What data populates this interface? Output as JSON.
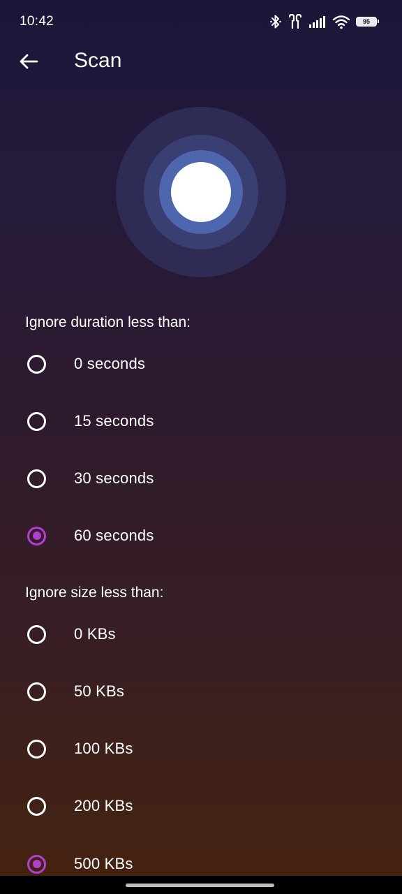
{
  "status_bar": {
    "time": "10:42",
    "battery_level": "95",
    "icons": [
      "bluetooth-icon",
      "earbuds-icon",
      "signal-icon",
      "wifi-icon",
      "battery-icon"
    ]
  },
  "app_bar": {
    "back_icon": "arrow-left-icon",
    "title": "Scan"
  },
  "scan_visual": {
    "icon": "scan-pulse-icon",
    "colors": {
      "outer": "#2e2c55",
      "middle": "#3a3f73",
      "inner": "#4d66ad",
      "core": "#ffffff"
    }
  },
  "duration_section": {
    "title": "Ignore duration less than:",
    "options": [
      {
        "label": "0 seconds",
        "selected": false
      },
      {
        "label": "15 seconds",
        "selected": false
      },
      {
        "label": "30 seconds",
        "selected": false
      },
      {
        "label": "60 seconds",
        "selected": true
      }
    ]
  },
  "size_section": {
    "title": "Ignore size less than:",
    "options": [
      {
        "label": "0 KBs",
        "selected": false
      },
      {
        "label": "50 KBs",
        "selected": false
      },
      {
        "label": "100 KBs",
        "selected": false
      },
      {
        "label": "200 KBs",
        "selected": false
      },
      {
        "label": "500 KBs",
        "selected": true
      }
    ]
  },
  "theme": {
    "accent": "#b23fd0",
    "text": "#ffffff",
    "bg_top": "#1d1638",
    "bg_bottom": "#45230f"
  }
}
